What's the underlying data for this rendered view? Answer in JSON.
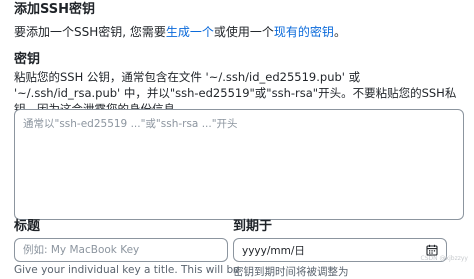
{
  "header": {
    "title": "添加SSH密钥"
  },
  "intro": {
    "prefix": "要添加一个SSH密钥, 您需要",
    "generate_link": "生成一个",
    "middle": "或使用一个",
    "existing_link": "现有的密钥",
    "suffix": "。"
  },
  "key": {
    "label": "密钥",
    "help": "粘贴您的SSH 公钥，通常包含在文件 '~/.ssh/id_ed25519.pub' 或 '~/.ssh/id_rsa.pub' 中，并以\"ssh-ed25519\"或\"ssh-rsa\"开头。不要粘贴您的SSH私钥，因为这会泄露您的身份信息。",
    "placeholder": "通常以\"ssh-ed25519 ...\"或\"ssh-rsa ...\"开头"
  },
  "title_field": {
    "label": "标题",
    "placeholder": "例如: My MacBook Key",
    "hint": "Give your individual key a title. This will be"
  },
  "expiration": {
    "label": "到期于",
    "value": "yyyy/mm/日",
    "icon": "calendar-icon",
    "hint": "密钥到期时间将被调整为"
  },
  "watermark": "CSDN @xjbzzyy"
}
